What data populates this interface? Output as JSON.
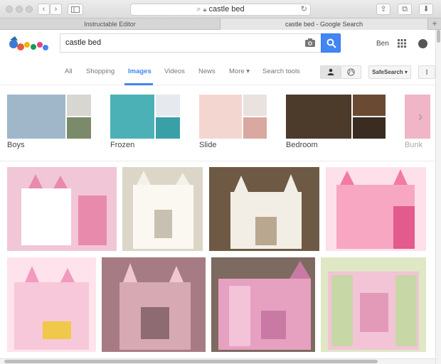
{
  "browser": {
    "address": "castle bed",
    "tabs": [
      {
        "label": "Instructable Editor",
        "active": false
      },
      {
        "label": "castle bed - Google Search",
        "active": true
      }
    ],
    "new_tab": "+"
  },
  "google": {
    "query": "castle bed",
    "user_name": "Ben",
    "nav": [
      "All",
      "Shopping",
      "Images",
      "Videos",
      "News",
      "More ▾",
      "Search tools"
    ],
    "active_nav": "Images",
    "safesearch_label": "SafeSearch ▾"
  },
  "categories": [
    {
      "label": "Boys",
      "colors": [
        "#9fb7c9",
        "#d8d6d0",
        "#7a8a6a",
        "#b9a98a"
      ]
    },
    {
      "label": "Frozen",
      "colors": [
        "#4bb1b7",
        "#e6e9ee",
        "#3aa0a8",
        "#a9c6d6"
      ]
    },
    {
      "label": "Slide",
      "colors": [
        "#f4d6d0",
        "#e9e2df",
        "#d8a8a1",
        "#efd2d6"
      ]
    },
    {
      "label": "Bedroom",
      "colors": [
        "#4c3a2a",
        "#6b4a34",
        "#3a2c21",
        "#8a6a4a"
      ]
    },
    {
      "label": "Bunk",
      "colors": [
        "#f0b5c6"
      ]
    }
  ],
  "images_row1": [
    {
      "colors": [
        "#f1c6d6",
        "#e88aac",
        "#ffffff",
        "#c9c4c8"
      ]
    },
    {
      "colors": [
        "#f4f1ea",
        "#dcd6c8",
        "#fbf8f2",
        "#c8c0b0"
      ]
    },
    {
      "colors": [
        "#d9cfc0",
        "#b9a88f",
        "#f2eee6",
        "#6e5a44"
      ]
    },
    {
      "colors": [
        "#f7a7c2",
        "#f27aa3",
        "#fde0ea",
        "#e35a8c"
      ]
    }
  ],
  "images_row2": [
    {
      "colors": [
        "#f7c8d9",
        "#f19bbd",
        "#ffe3ec",
        "#f0c84a"
      ]
    },
    {
      "colors": [
        "#d7a9b3",
        "#a77b84",
        "#efc7d0",
        "#8e6b73"
      ]
    },
    {
      "colors": [
        "#e6a0c0",
        "#c87aa4",
        "#f3c3d8",
        "#7d6a60"
      ]
    },
    {
      "colors": [
        "#c7d7a6",
        "#f2c4d6",
        "#dfe7c4",
        "#e39ab8"
      ]
    }
  ]
}
